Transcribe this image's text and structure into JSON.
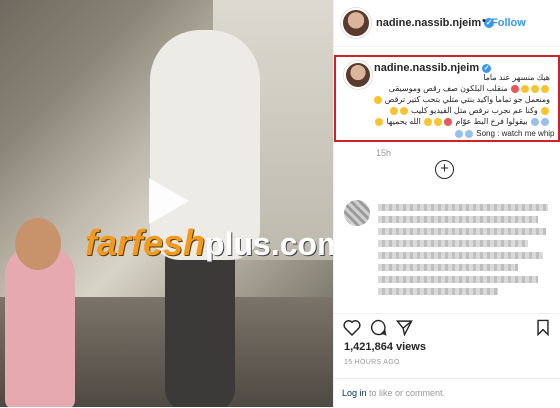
{
  "post": {
    "author": "nadine.nassib.njeim",
    "follow_label": "Follow",
    "separator": "•",
    "caption": {
      "line1": "هيك منسهر عند ماما",
      "line2": "منقلب البلكون صف رقص وموسيقى",
      "line3": "ومنعمل جو تماما واكيد بنتي متلي بتحب كتير ترقص",
      "line4": "وكنا عم نجرب نرقص متل الفيديو كليب",
      "line5": "بيقولوا فرخ البط عوّام",
      "line5b": "الله يحميها",
      "song": "Song : watch me whip"
    },
    "time": "15h",
    "load_more": "+",
    "likes": "1,421,864 views",
    "posted_ago": "15 HOURS AGO",
    "login_link": "Log in",
    "login_text": " to like or comment."
  },
  "media": {
    "watermark_part1": "farfesh",
    "watermark_part2": "plus.com"
  },
  "colors": {
    "accent": "#3897f0",
    "highlight_border": "#d0202a",
    "watermark_orange": "#f39a1d"
  },
  "icons": [
    "play-icon",
    "verified-icon",
    "heart-icon",
    "comment-icon",
    "share-icon",
    "bookmark-icon",
    "add-icon"
  ]
}
